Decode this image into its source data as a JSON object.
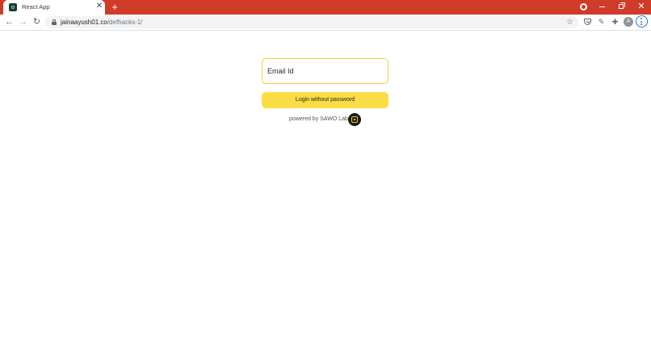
{
  "browser": {
    "tab": {
      "title": "React App",
      "favicon": "react-app-favicon",
      "close_glyph": "✕"
    },
    "new_tab_glyph": "+",
    "window_controls": {
      "record": "record-icon",
      "minimize": "minimize-icon",
      "restore": "restore-icon",
      "close_glyph": "✕"
    },
    "nav": {
      "back_glyph": "←",
      "forward_glyph": "→",
      "reload_glyph": "↻"
    },
    "address": {
      "host": "jainaayush01.co",
      "path": "/defhacks-1/"
    },
    "toolbar_icons": {
      "bookmark_glyph": "☆",
      "pocket": "pocket-icon",
      "eyedropper_glyph": "✎",
      "extensions_glyph": "✚",
      "avatar_letter": "A",
      "menu": "menu-icon"
    },
    "accent_color": "#d03b2a"
  },
  "login": {
    "email_placeholder": "Email Id",
    "email_value": "",
    "submit_label": "Login without password",
    "powered_by": "powered by SAWO Labs",
    "logo": "sawo-labs-logo",
    "input_border_color": "#f5cf3a",
    "button_color": "#fcdc44"
  }
}
